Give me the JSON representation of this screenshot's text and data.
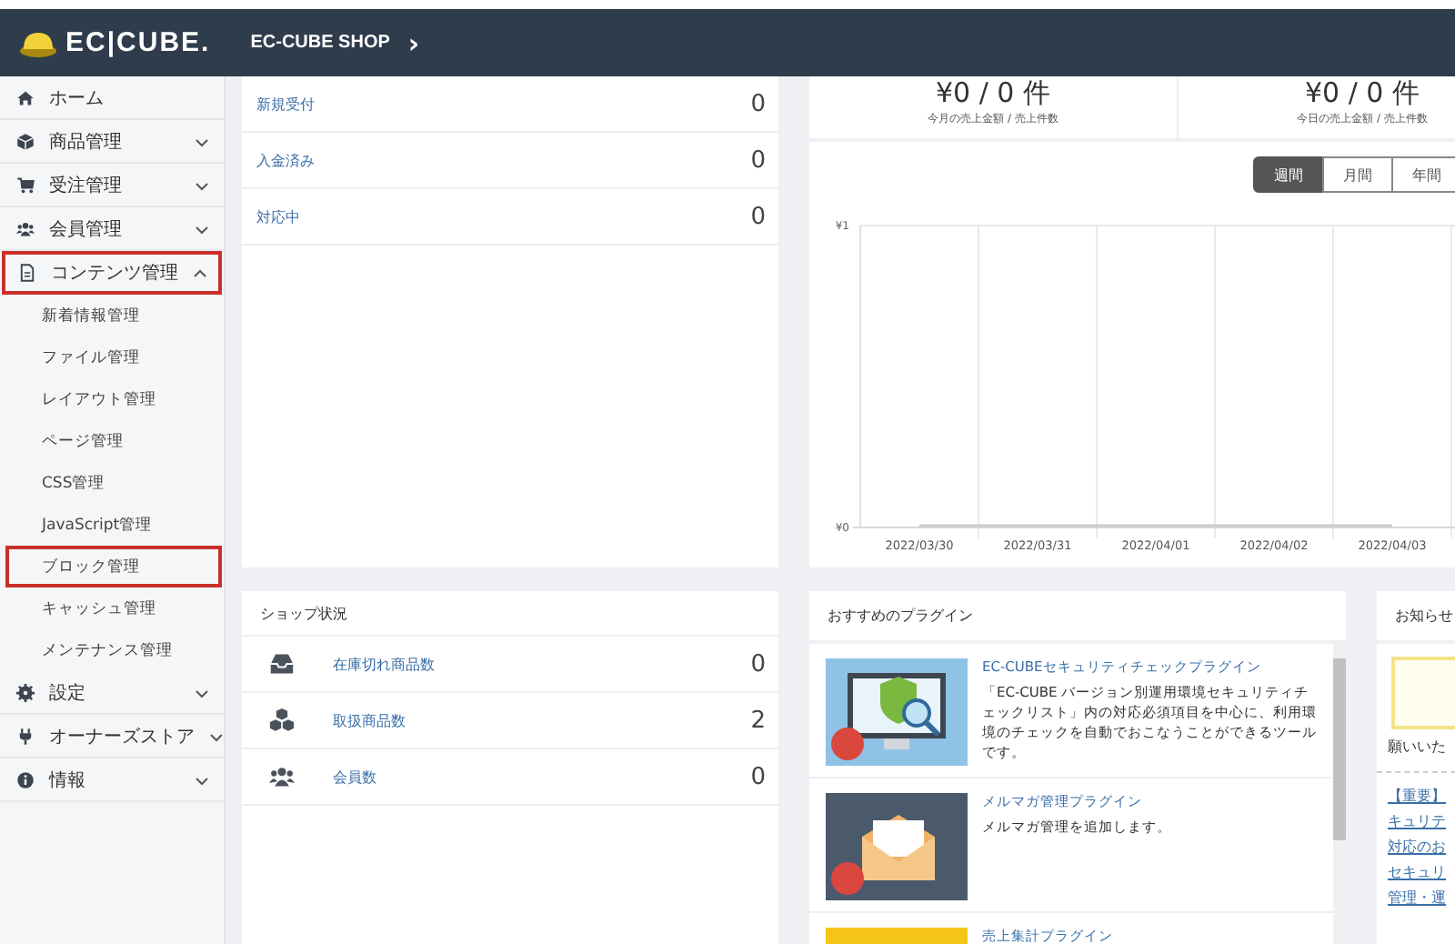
{
  "header": {
    "logo": "EC|CUBE.",
    "shop_name": "EC-CUBE SHOP",
    "chevron": "›"
  },
  "sidebar": {
    "items": [
      {
        "label": "ホーム",
        "highlighted": false
      },
      {
        "label": "商品管理",
        "expanded": false,
        "highlighted": false
      },
      {
        "label": "受注管理",
        "expanded": false,
        "highlighted": false
      },
      {
        "label": "会員管理",
        "expanded": false,
        "highlighted": false
      },
      {
        "label": "コンテンツ管理",
        "expanded": true,
        "highlighted": true,
        "children": [
          {
            "label": "新着情報管理",
            "highlighted": false
          },
          {
            "label": "ファイル管理",
            "highlighted": false
          },
          {
            "label": "レイアウト管理",
            "highlighted": false
          },
          {
            "label": "ページ管理",
            "highlighted": false
          },
          {
            "label": "CSS管理",
            "highlighted": false
          },
          {
            "label": "JavaScript管理",
            "highlighted": false
          },
          {
            "label": "ブロック管理",
            "highlighted": true
          },
          {
            "label": "キャッシュ管理",
            "highlighted": false
          },
          {
            "label": "メンテナンス管理",
            "highlighted": false
          }
        ]
      },
      {
        "label": "設定",
        "expanded": false,
        "highlighted": false
      },
      {
        "label": "オーナーズストア",
        "expanded": false,
        "highlighted": false
      },
      {
        "label": "情報",
        "expanded": false,
        "highlighted": false
      }
    ]
  },
  "order_status": {
    "rows": [
      {
        "label": "新規受付",
        "value": "0"
      },
      {
        "label": "入金済み",
        "value": "0"
      },
      {
        "label": "対応中",
        "value": "0"
      }
    ]
  },
  "sales": {
    "summaries": [
      {
        "value": "¥0 / 0 件",
        "caption": "今月の売上金額 / 売上件数"
      },
      {
        "value": "¥0 / 0 件",
        "caption": "今日の売上金額 / 売上件数"
      }
    ],
    "periods": [
      {
        "label": "週間",
        "selected": true
      },
      {
        "label": "月間",
        "selected": false
      },
      {
        "label": "年間",
        "selected": false
      }
    ],
    "chart_data": {
      "type": "line",
      "categories": [
        "2022/03/30",
        "2022/03/31",
        "2022/04/01",
        "2022/04/02",
        "2022/04/03"
      ],
      "series": [
        {
          "color": "#c8ccd2",
          "values": [
            0,
            0,
            0,
            0,
            0
          ]
        }
      ],
      "ylim": [
        0,
        1
      ],
      "yticks": [
        {
          "value": 0,
          "label": "¥0"
        },
        {
          "value": 1,
          "label": "¥1"
        }
      ]
    }
  },
  "shop_status": {
    "title": "ショップ状況",
    "rows": [
      {
        "label": "在庫切れ商品数",
        "value": "0"
      },
      {
        "label": "取扱商品数",
        "value": "2"
      },
      {
        "label": "会員数",
        "value": "0"
      }
    ]
  },
  "plugins": {
    "title": "おすすめのプラグイン",
    "items": [
      {
        "title": "EC-CUBEセキュリティチェックプラグイン",
        "description": "「EC-CUBE バージョン別運用環境セキュリティチェックリスト」内の対応必須項目を中心に、利用環境のチェックを自動でおこなうことができるツールです。",
        "kind": "security"
      },
      {
        "title": "メルマガ管理プラグイン",
        "description": "メルマガ管理を追加します。",
        "kind": "mail"
      },
      {
        "title": "売上集計プラグイン",
        "kind": "sales"
      }
    ]
  },
  "news": {
    "title": "お知らせ",
    "excerpt": "願いいた",
    "links": [
      "【重要】",
      "キュリテ",
      "対応のお",
      "セキュリ",
      "管理・運"
    ]
  }
}
